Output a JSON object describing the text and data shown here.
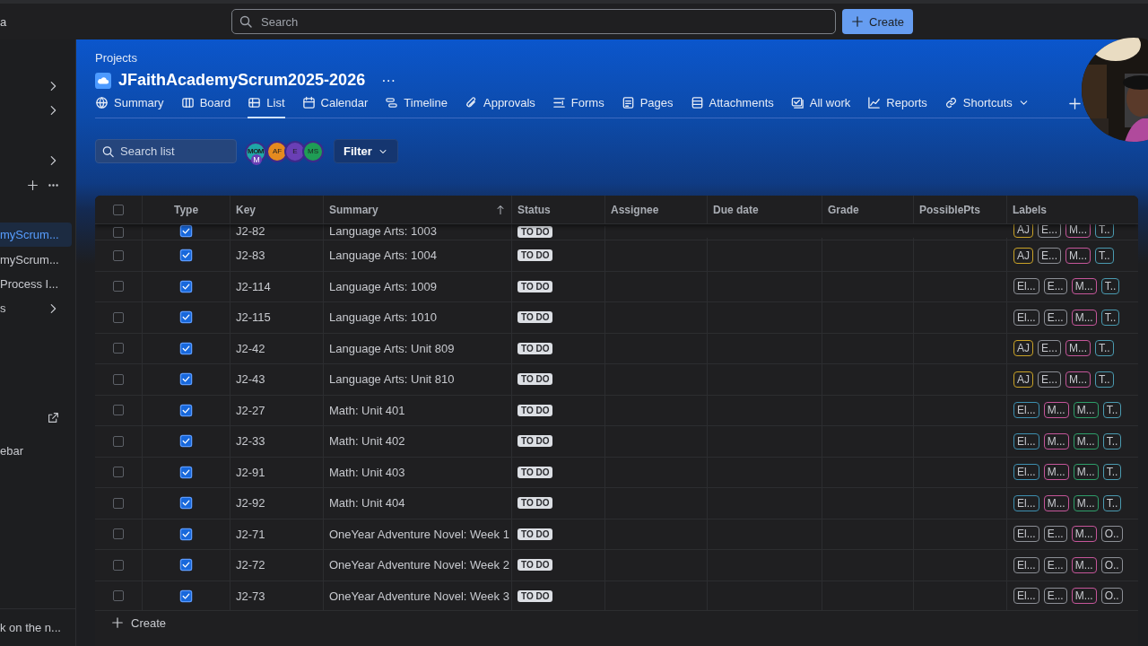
{
  "top_bar": {
    "partial_text": "a",
    "search": {
      "placeholder": "Search"
    },
    "create_button": "Create"
  },
  "sidebar": {
    "items": [
      {
        "kind": "chevron",
        "selected": false
      },
      {
        "kind": "chevron",
        "selected": false
      },
      {
        "kind": "chevron",
        "selected": false
      },
      {
        "kind": "actions"
      },
      {
        "kind": "item",
        "text": "myScrum...",
        "selected": true
      },
      {
        "kind": "item",
        "text": "myScrum...",
        "selected": false
      },
      {
        "kind": "item",
        "text": "Process I...",
        "selected": false
      },
      {
        "kind": "chevron",
        "text": "s",
        "selected": false
      },
      {
        "kind": "link"
      },
      {
        "kind": "item",
        "text": "ebar",
        "selected": false
      }
    ],
    "footer": "k on the n..."
  },
  "project": {
    "breadcrumb": "Projects",
    "title": "JFaithAcademyScrum2025-2026",
    "more": "···"
  },
  "tabs": [
    {
      "label": "Summary",
      "selected": false
    },
    {
      "label": "Board",
      "selected": false
    },
    {
      "label": "List",
      "selected": true
    },
    {
      "label": "Calendar",
      "selected": false
    },
    {
      "label": "Timeline",
      "selected": false
    },
    {
      "label": "Approvals",
      "selected": false
    },
    {
      "label": "Forms",
      "selected": false
    },
    {
      "label": "Pages",
      "selected": false
    },
    {
      "label": "Attachments",
      "selected": false
    },
    {
      "label": "All work",
      "selected": false
    },
    {
      "label": "Reports",
      "selected": false
    },
    {
      "label": "Shortcuts",
      "selected": false,
      "dropdown": true
    }
  ],
  "toolbar": {
    "search": {
      "placeholder": "Search list"
    },
    "avatars": [
      {
        "initials": "MOM",
        "color": "#1fa7a7"
      },
      {
        "initials": "AF",
        "color": "#e58a1f"
      },
      {
        "initials": "E",
        "color": "#6a3fb5"
      },
      {
        "initials": "MS",
        "color": "#1f9d55"
      }
    ],
    "avatar_badge": "M",
    "filter": "Filter"
  },
  "table": {
    "all_selected": false,
    "columns": [
      {
        "label": "Type",
        "sorted": false
      },
      {
        "label": "Key",
        "sorted": false
      },
      {
        "label": "Summary",
        "sorted": true
      },
      {
        "label": "Status",
        "sorted": false
      },
      {
        "label": "Assignee",
        "sorted": false
      },
      {
        "label": "Due date",
        "sorted": false
      },
      {
        "label": "Grade",
        "sorted": false
      },
      {
        "label": "PossiblePts",
        "sorted": false
      },
      {
        "label": "Labels",
        "sorted": false
      }
    ],
    "rows": [
      {
        "selected": false,
        "kind": "task",
        "key": "J2-82",
        "summary": "Language Arts: 1003",
        "status": "TO DO",
        "labels": [
          {
            "text": "AJ",
            "color": "#c9a227"
          },
          {
            "text": "E...",
            "color": "#8c8f96"
          },
          {
            "text": "M...",
            "color": "#c5569a"
          },
          {
            "text": "T..",
            "color": "#4a9ab0"
          }
        ]
      },
      {
        "selected": false,
        "kind": "task",
        "key": "J2-83",
        "summary": "Language Arts: 1004",
        "status": "TO DO",
        "labels": [
          {
            "text": "AJ",
            "color": "#c9a227"
          },
          {
            "text": "E...",
            "color": "#8c8f96"
          },
          {
            "text": "M...",
            "color": "#c5569a"
          },
          {
            "text": "T..",
            "color": "#4a9ab0"
          }
        ]
      },
      {
        "selected": false,
        "kind": "task",
        "key": "J2-114",
        "summary": "Language Arts: 1009",
        "status": "TO DO",
        "labels": [
          {
            "text": "El...",
            "color": "#8c8f96"
          },
          {
            "text": "E...",
            "color": "#8c8f96"
          },
          {
            "text": "M...",
            "color": "#c5569a"
          },
          {
            "text": "T..",
            "color": "#4a9ab0"
          }
        ]
      },
      {
        "selected": false,
        "kind": "task",
        "key": "J2-115",
        "summary": "Language Arts: 1010",
        "status": "TO DO",
        "labels": [
          {
            "text": "El...",
            "color": "#8c8f96"
          },
          {
            "text": "E...",
            "color": "#8c8f96"
          },
          {
            "text": "M...",
            "color": "#c5569a"
          },
          {
            "text": "T..",
            "color": "#4a9ab0"
          }
        ]
      },
      {
        "selected": false,
        "kind": "task",
        "key": "J2-42",
        "summary": "Language Arts: Unit 809",
        "status": "TO DO",
        "labels": [
          {
            "text": "AJ",
            "color": "#c9a227"
          },
          {
            "text": "E...",
            "color": "#8c8f96"
          },
          {
            "text": "M...",
            "color": "#c5569a"
          },
          {
            "text": "T..",
            "color": "#4a9ab0"
          }
        ]
      },
      {
        "selected": false,
        "kind": "task",
        "key": "J2-43",
        "summary": "Language Arts: Unit 810",
        "status": "TO DO",
        "labels": [
          {
            "text": "AJ",
            "color": "#c9a227"
          },
          {
            "text": "E...",
            "color": "#8c8f96"
          },
          {
            "text": "M...",
            "color": "#c5569a"
          },
          {
            "text": "T..",
            "color": "#4a9ab0"
          }
        ]
      },
      {
        "selected": false,
        "kind": "task",
        "key": "J2-27",
        "summary": "Math: Unit 401",
        "status": "TO DO",
        "labels": [
          {
            "text": "El...",
            "color": "#3d8fb0"
          },
          {
            "text": "M...",
            "color": "#c5569a"
          },
          {
            "text": "M...",
            "color": "#2e9e6a"
          },
          {
            "text": "T..",
            "color": "#4a9ab0"
          }
        ]
      },
      {
        "selected": false,
        "kind": "task",
        "key": "J2-33",
        "summary": "Math: Unit 402",
        "status": "TO DO",
        "labels": [
          {
            "text": "El...",
            "color": "#3d8fb0"
          },
          {
            "text": "M...",
            "color": "#c5569a"
          },
          {
            "text": "M...",
            "color": "#2e9e6a"
          },
          {
            "text": "T..",
            "color": "#4a9ab0"
          }
        ]
      },
      {
        "selected": false,
        "kind": "task",
        "key": "J2-91",
        "summary": "Math: Unit 403",
        "status": "TO DO",
        "labels": [
          {
            "text": "El...",
            "color": "#3d8fb0"
          },
          {
            "text": "M...",
            "color": "#c5569a"
          },
          {
            "text": "M...",
            "color": "#2e9e6a"
          },
          {
            "text": "T..",
            "color": "#4a9ab0"
          }
        ]
      },
      {
        "selected": false,
        "kind": "task",
        "key": "J2-92",
        "summary": "Math: Unit 404",
        "status": "TO DO",
        "labels": [
          {
            "text": "El...",
            "color": "#3d8fb0"
          },
          {
            "text": "M...",
            "color": "#c5569a"
          },
          {
            "text": "M...",
            "color": "#2e9e6a"
          },
          {
            "text": "T..",
            "color": "#4a9ab0"
          }
        ]
      },
      {
        "selected": false,
        "kind": "task",
        "key": "J2-71",
        "summary": "OneYear Adventure Novel: Week 1",
        "status": "TO DO",
        "labels": [
          {
            "text": "El...",
            "color": "#8c8f96"
          },
          {
            "text": "E...",
            "color": "#8c8f96"
          },
          {
            "text": "M...",
            "color": "#c5569a"
          },
          {
            "text": "O..",
            "color": "#8c8f96"
          }
        ]
      },
      {
        "selected": false,
        "kind": "task",
        "key": "J2-72",
        "summary": "OneYear Adventure Novel: Week 2",
        "status": "TO DO",
        "labels": [
          {
            "text": "El...",
            "color": "#8c8f96"
          },
          {
            "text": "E...",
            "color": "#8c8f96"
          },
          {
            "text": "M...",
            "color": "#c5569a"
          },
          {
            "text": "O..",
            "color": "#8c8f96"
          }
        ]
      },
      {
        "selected": false,
        "kind": "task",
        "key": "J2-73",
        "summary": "OneYear Adventure Novel: Week 3",
        "status": "TO DO",
        "labels": [
          {
            "text": "El...",
            "color": "#8c8f96"
          },
          {
            "text": "E...",
            "color": "#8c8f96"
          },
          {
            "text": "M...",
            "color": "#c5569a"
          },
          {
            "text": "O..",
            "color": "#8c8f96"
          }
        ]
      }
    ],
    "create": "Create"
  }
}
